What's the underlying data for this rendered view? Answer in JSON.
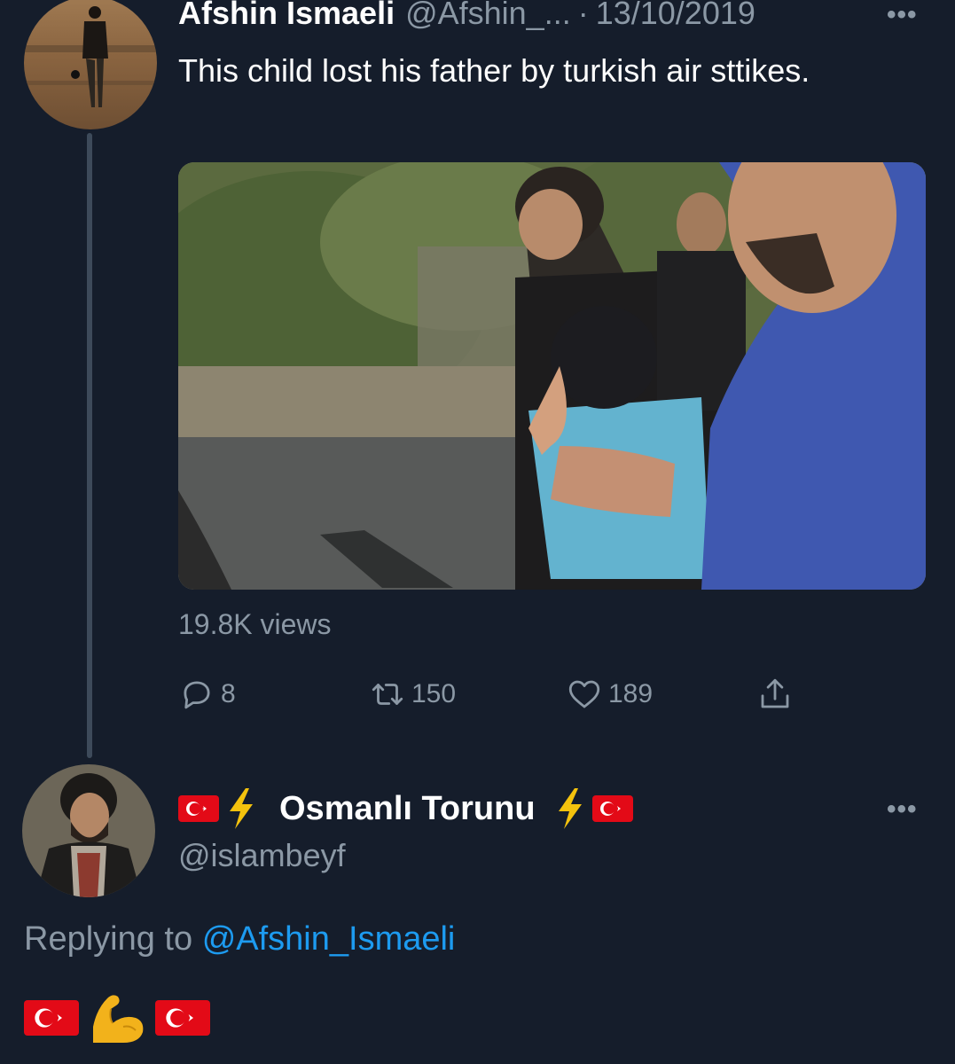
{
  "tweet": {
    "author_name": "Afshin Ismaeli",
    "author_handle": "@Afshin_...",
    "separator": "·",
    "date": "13/10/2019",
    "more": "•••",
    "text": "This child lost his father by turkish air sttikes.",
    "views": "19.8K views",
    "actions": {
      "replies": "8",
      "retweets": "150",
      "likes": "189"
    }
  },
  "reply": {
    "author_name": "Osmanlı Torunu",
    "author_handle": "@islambeyf",
    "more": "•••",
    "replying_prefix": "Replying to",
    "replying_to": "@Afshin_Ismaeli",
    "body_emoji": [
      "turkish-flag",
      "flexed-biceps",
      "turkish-flag"
    ]
  },
  "colors": {
    "background": "#151d2b",
    "secondary_text": "#8b98a5",
    "link": "#1d9bf0",
    "flag_red": "#e30a17",
    "bolt_yellow": "#f4c20d"
  }
}
